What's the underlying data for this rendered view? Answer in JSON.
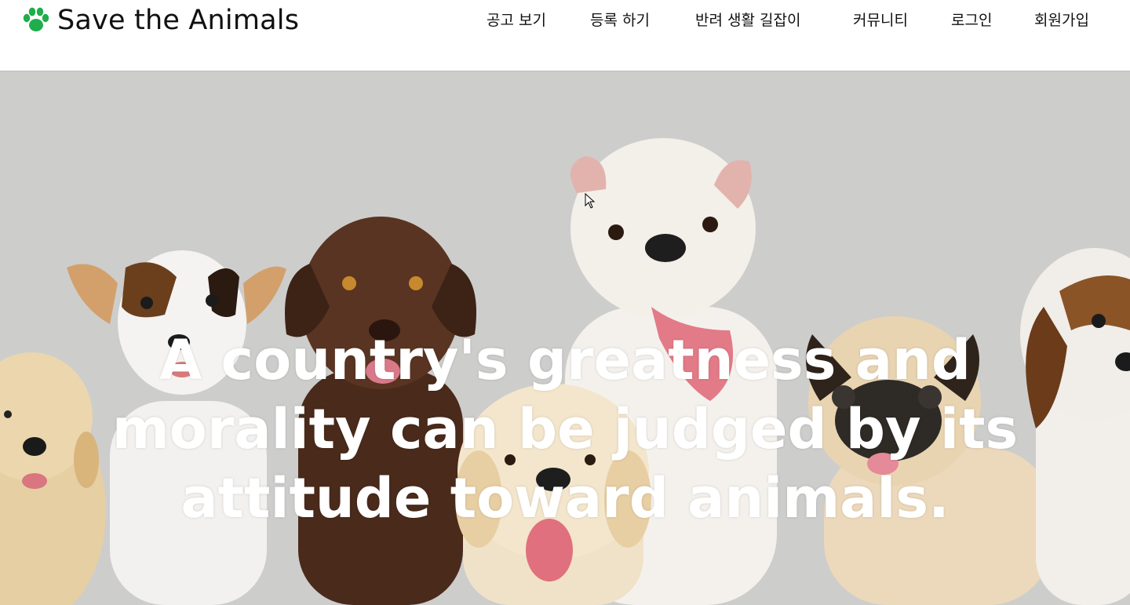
{
  "header": {
    "brand": "Save the Animals",
    "logo_icon": "paw-icon",
    "accent_color": "#1fae4b",
    "nav": [
      {
        "label": "공고 보기"
      },
      {
        "label": "등록 하기"
      },
      {
        "label": "반려 생활 길잡이"
      },
      {
        "label": "커뮤니티"
      },
      {
        "label": "로그인"
      },
      {
        "label": "회원가입"
      }
    ]
  },
  "hero": {
    "quote": "A country's greatness and morality can be judged by its attitude toward animals.",
    "background_color": "#cdcdcc"
  }
}
